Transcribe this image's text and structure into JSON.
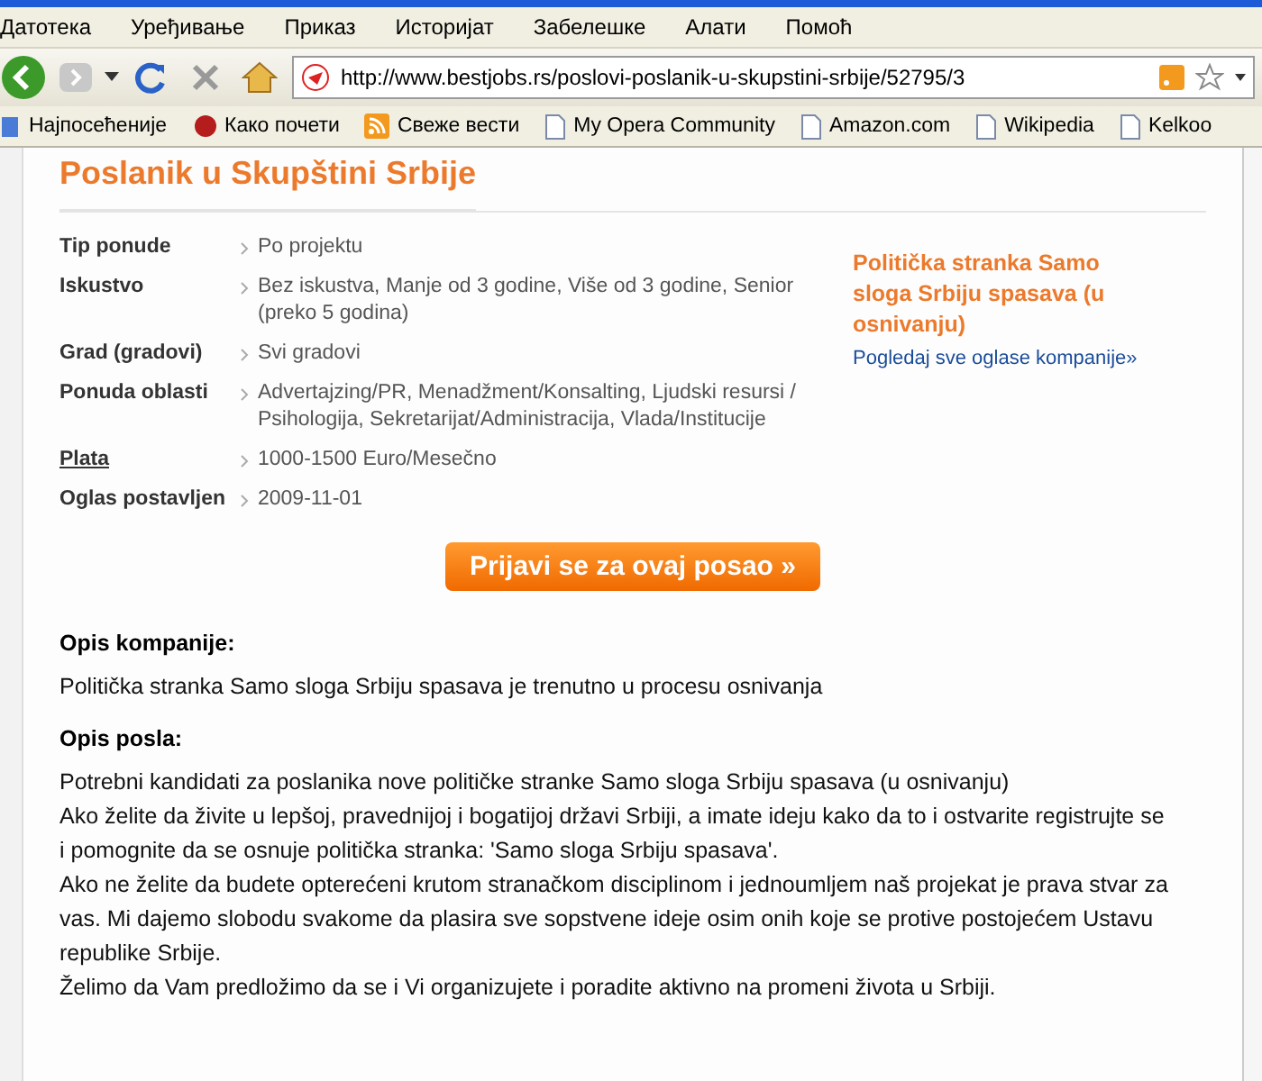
{
  "menu": [
    "Датотека",
    "Уређивање",
    "Приказ",
    "Историјат",
    "Забелешке",
    "Алати",
    "Помоћ"
  ],
  "address": "http://www.bestjobs.rs/poslovi-poslanik-u-skupstini-srbije/52795/3",
  "bookmarks": [
    {
      "label": "Најпосећеније",
      "kind": "folder"
    },
    {
      "label": "Како почети",
      "kind": "bug"
    },
    {
      "label": "Свеже вести",
      "kind": "feed"
    },
    {
      "label": "My Opera Community",
      "kind": "page"
    },
    {
      "label": "Amazon.com",
      "kind": "page"
    },
    {
      "label": "Wikipedia",
      "kind": "page"
    },
    {
      "label": "Kelkoo",
      "kind": "page"
    }
  ],
  "title": "Poslanik u Skupštini Srbije",
  "details": [
    {
      "label": "Tip ponude",
      "value": "Po projektu",
      "link": false
    },
    {
      "label": "Iskustvo",
      "value": "Bez iskustva, Manje od 3 godine, Više od 3 godine, Senior (preko 5 godina)",
      "link": false
    },
    {
      "label": "Grad (gradovi)",
      "value": "Svi gradovi",
      "link": false
    },
    {
      "label": "Ponuda oblasti",
      "value": "Advertajzing/PR, Menadžment/Konsalting, Ljudski resursi / Psihologija, Sekretarijat/Administracija, Vlada/Institucije",
      "link": false
    },
    {
      "label": "Plata",
      "value": "1000-1500 Euro/Mesečno",
      "link": true
    },
    {
      "label": "Oglas postavljen",
      "value": "2009-11-01",
      "link": false
    }
  ],
  "company": {
    "name": "Politička stranka Samo sloga Srbiju spasava (u osnivanju)",
    "link": "Pogledaj sve oglase kompanije»"
  },
  "apply_button": "Prijavi se za ovaj posao »",
  "sections": [
    {
      "heading": "Opis kompanije:",
      "paragraphs": [
        "Politička stranka Samo sloga Srbiju spasava je trenutno u procesu osnivanja"
      ]
    },
    {
      "heading": "Opis posla:",
      "paragraphs": [
        "Potrebni kandidati za poslanika nove političke stranke Samo sloga Srbiju spasava (u osnivanju)",
        "Ako želite da živite u lepšoj, pravednijoj i bogatijoj državi Srbiji, a imate ideju kako da to i ostvarite registrujte se i pomognite da se osnuje politička stranka: 'Samo sloga Srbiju spasava'.",
        "Ako ne želite da budete opterećeni krutom stranačkom disciplinom i jednoumljem naš projekat je prava stvar za vas. Mi dajemo slobodu svakome da plasira sve sopstvene ideje osim onih koje se protive postojećem Ustavu republike Srbije.",
        "Želimo da Vam predložimo da se i Vi organizujete i poradite aktivno na promeni života u Srbiji."
      ]
    }
  ]
}
